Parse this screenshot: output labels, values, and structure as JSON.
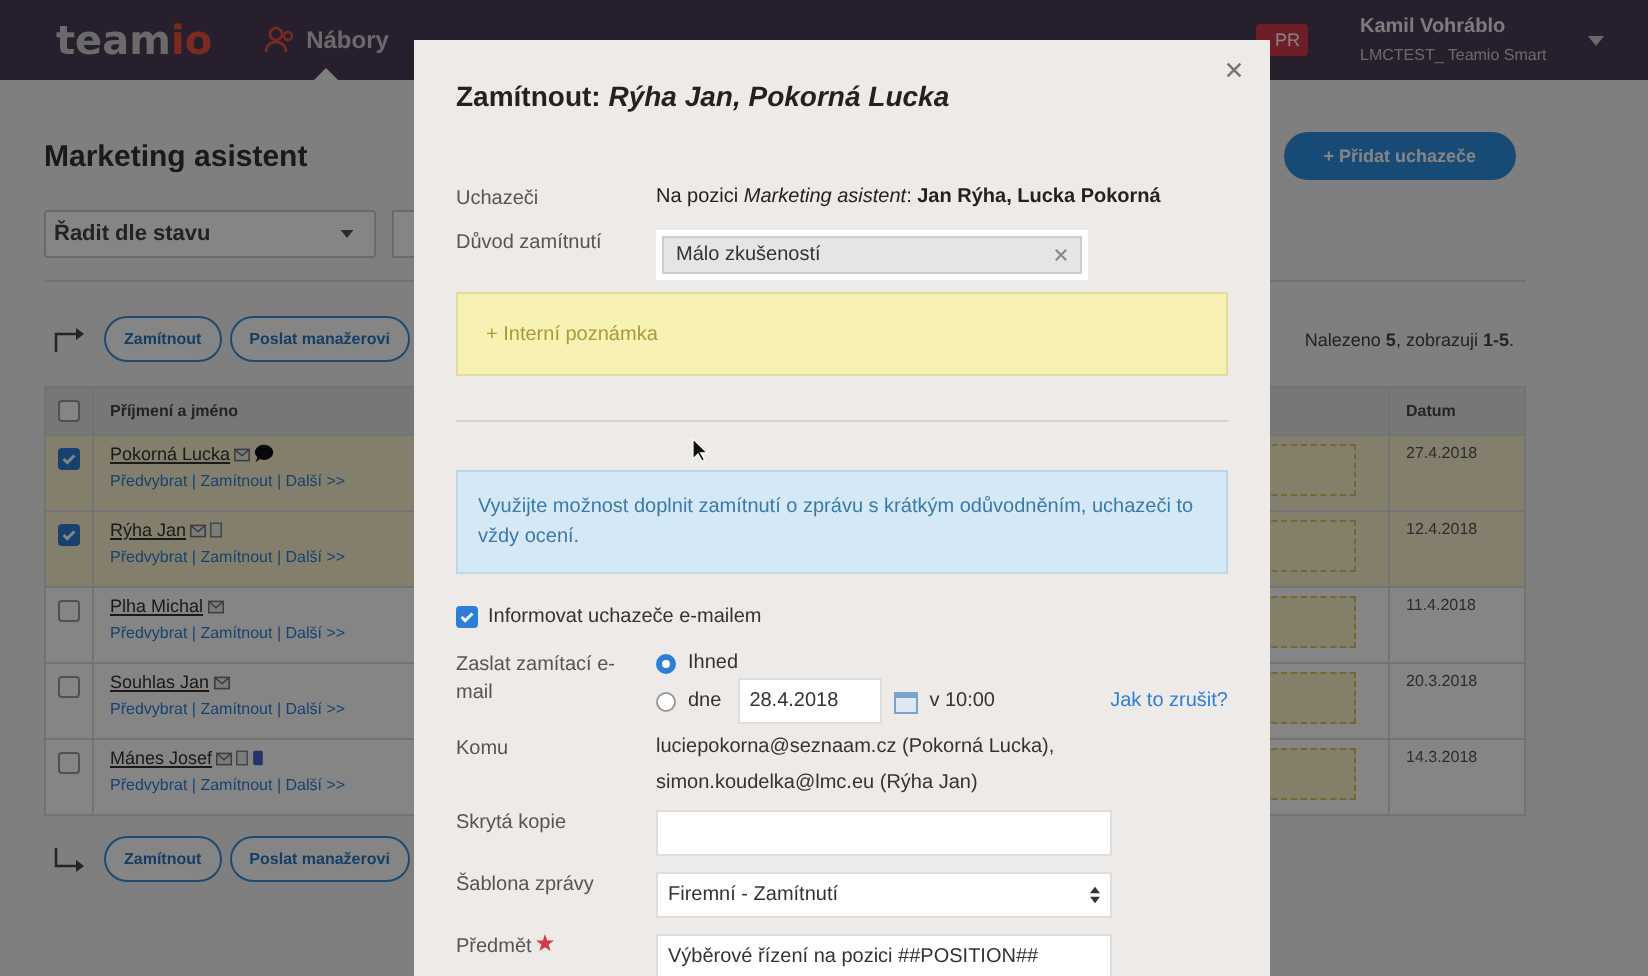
{
  "top_bar": {
    "logo_prefix": "team",
    "logo_suffix": "io",
    "nav": [
      {
        "label": "Nábory",
        "selected": true
      }
    ],
    "badge": "PR",
    "user_name": "Kamil Vohráblo",
    "account": "LMCTEST_ Teamio Smart"
  },
  "page": {
    "title": "Marketing asistent",
    "add_button": "+ Přidat uchazeče",
    "sort_select": "Řadit dle stavu",
    "bulk_actions_top": [
      "Zamítnout",
      "Poslat manažerovi"
    ],
    "result_count": "Nalezeno **5**, zobrazuji **1-5**.",
    "table": {
      "select_all_checked": false,
      "columns": [
        "Příjmení a jméno",
        "Datum"
      ],
      "rows": [
        {
          "name": "Pokorná Lucka",
          "checked": true,
          "email": true,
          "comment": true,
          "document": false,
          "phone": false,
          "actions": "Předvybrat | Zamítnout | Další >>",
          "date": "27.4.2018"
        },
        {
          "name": "Rýha Jan",
          "checked": true,
          "email": true,
          "comment": false,
          "document": true,
          "phone": false,
          "actions": "Předvybrat | Zamítnout | Další >>",
          "date": "12.4.2018"
        },
        {
          "name": "Plha Michal",
          "checked": false,
          "email": true,
          "comment": false,
          "document": false,
          "phone": false,
          "actions": "Předvybrat | Zamítnout | Další >>",
          "date": "11.4.2018"
        },
        {
          "name": "Souhlas Jan",
          "checked": false,
          "email": true,
          "comment": false,
          "document": false,
          "phone": false,
          "actions": "Předvybrat | Zamítnout | Další >>",
          "date": "20.3.2018"
        },
        {
          "name": "Mánes Josef",
          "checked": false,
          "email": true,
          "comment": false,
          "document": true,
          "phone": true,
          "actions": "Předvybrat | Zamítnout | Další >>",
          "date": "14.3.2018"
        }
      ]
    },
    "bulk_actions_bottom": [
      "Zamítnout",
      "Poslat manažerovi"
    ]
  },
  "modal": {
    "title": "Zamítnout: *Rýha Jan, Pokorná Lucka*",
    "candidates": {
      "label": "Uchazeči",
      "value": "Na pozici *Marketing asistent*: **Jan Rýha, Lucka Pokorná**"
    },
    "reason": {
      "label": "Důvod zamítnutí",
      "tag": "Málo zkušeností"
    },
    "note_button": "+ Interní poznámka",
    "info": "Využijte možnost doplnit zamítnutí o zprávu s krátkým odůvodněním, uchazeči to vždy ocení.",
    "notify": {
      "label": "Informovat uchazeče e-mailem",
      "checked": true
    },
    "send": {
      "label": "Zaslat zamítací e-mail",
      "options": [
        {
          "label": "Ihned",
          "selected": true
        },
        {
          "label": "dne",
          "selected": false
        }
      ],
      "date": "28.4.2018",
      "time": "v 10:00",
      "help_link": "Jak to zrušit?"
    },
    "recipients": {
      "label": "Komu",
      "lines": [
        "luciepokorna@seznaam.cz (Pokorná Lucka),",
        "simon.koudelka@lmc.eu (Rýha Jan)"
      ]
    },
    "bcc": {
      "label": "Skrytá kopie"
    },
    "template": {
      "label": "Šablona zprávy",
      "value": "Firemní - Zamítnutí"
    },
    "subject": {
      "label": "Předmět",
      "required": true,
      "value": "Výběrové řízení na pozici ##POSITION##"
    }
  }
}
